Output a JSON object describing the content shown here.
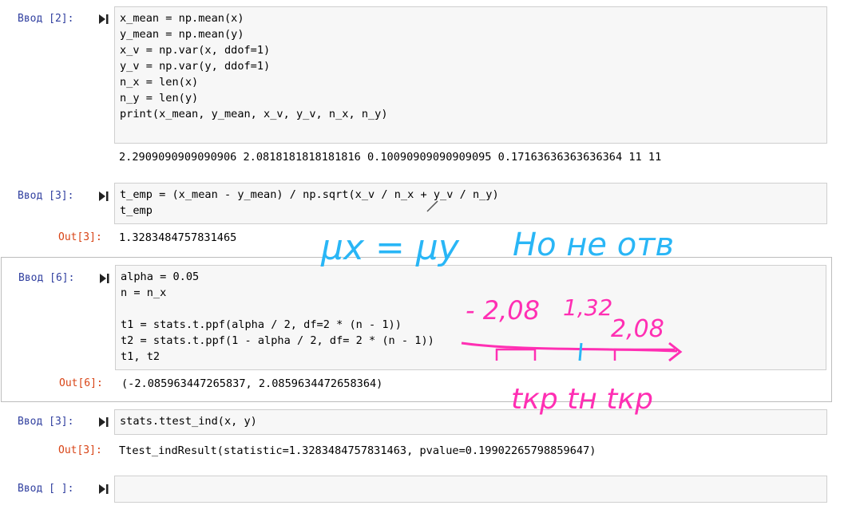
{
  "cells": [
    {
      "prompt": "Ввод [2]:",
      "code": "x_mean = np.mean(x)\ny_mean = np.mean(y)\nx_v = np.var(x, ddof=1)\ny_v = np.var(y, ddof=1)\nn_x = len(x)\nn_y = len(y)\nprint(x_mean, y_mean, x_v, y_v, n_x, n_y)",
      "output": "2.2909090909090906 2.0818181818181816 0.10090909090909095 0.17163636363636364 11 11"
    },
    {
      "prompt": "Ввод [3]:",
      "code": "t_emp = (x_mean - y_mean) / np.sqrt(x_v / n_x + y_v / n_y)\nt_emp",
      "out_prompt": "Out[3]:",
      "output": "1.3283484757831465"
    },
    {
      "prompt": "Ввод [6]:",
      "code": "alpha = 0.05\nn = n_x\n\nt1 = stats.t.ppf(alpha / 2, df=2 * (n - 1))\nt2 = stats.t.ppf(1 - alpha / 2, df= 2 * (n - 1))\nt1, t2",
      "out_prompt": "Out[6]:",
      "output": "(-2.085963447265837, 2.0859634472658364)"
    },
    {
      "prompt": "Ввод [3]:",
      "code": "stats.ttest_ind(x, y)",
      "out_prompt": "Out[3]:",
      "output": "Ttest_indResult(statistic=1.3283484757831463, pvalue=0.19902265798859647)"
    },
    {
      "prompt": "Ввод [ ]:",
      "code": ""
    }
  ],
  "annotations": {
    "blue_left": "μx = μy",
    "blue_right": "Но не отв",
    "neg": "- 2,08",
    "mid": "1,32",
    "pos": "2,08",
    "bottom": "tкр tн tкр"
  },
  "colors": {
    "prompt": "#303f9f",
    "out_prompt": "#d84315",
    "blue_ink": "#29b6f6",
    "pink_ink": "#ff2fb3"
  }
}
